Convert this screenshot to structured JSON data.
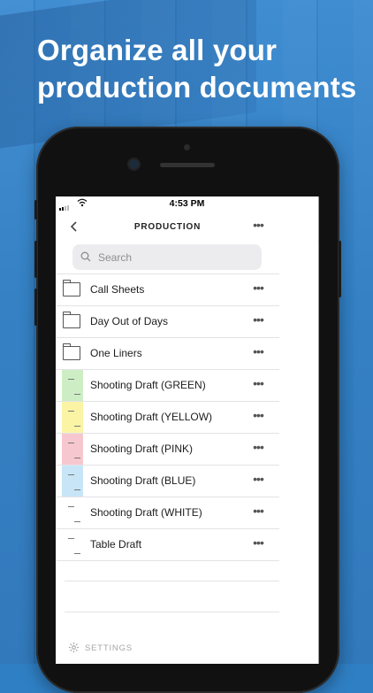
{
  "headline": {
    "line1": "Organize all your",
    "line2": "production documents"
  },
  "status_bar": {
    "time": "4:53 PM"
  },
  "nav": {
    "title": "PRODUCTION",
    "back_icon": "chevron-left-icon",
    "more_icon": "ellipsis-icon"
  },
  "search": {
    "placeholder": "Search",
    "icon": "magnifier-icon"
  },
  "items": [
    {
      "label": "Call Sheets",
      "type": "folder"
    },
    {
      "label": "Day Out of Days",
      "type": "folder"
    },
    {
      "label": "One Liners",
      "type": "folder"
    },
    {
      "label": "Shooting Draft (GREEN)",
      "type": "document",
      "color": "#cdeec4"
    },
    {
      "label": "Shooting Draft (YELLOW)",
      "type": "document",
      "color": "#fbf4a5"
    },
    {
      "label": "Shooting Draft (PINK)",
      "type": "document",
      "color": "#f7c7cf"
    },
    {
      "label": "Shooting Draft (BLUE)",
      "type": "document",
      "color": "#c7e5f7"
    },
    {
      "label": "Shooting Draft (WHITE)",
      "type": "document",
      "color": "#ffffff"
    },
    {
      "label": "Table Draft",
      "type": "document",
      "color": "#ffffff"
    }
  ],
  "footer": {
    "settings_label": "SETTINGS",
    "settings_icon": "gear-icon"
  },
  "colors": {
    "background_blue": "#2f7fc4",
    "divider": "#e3e3e6"
  }
}
